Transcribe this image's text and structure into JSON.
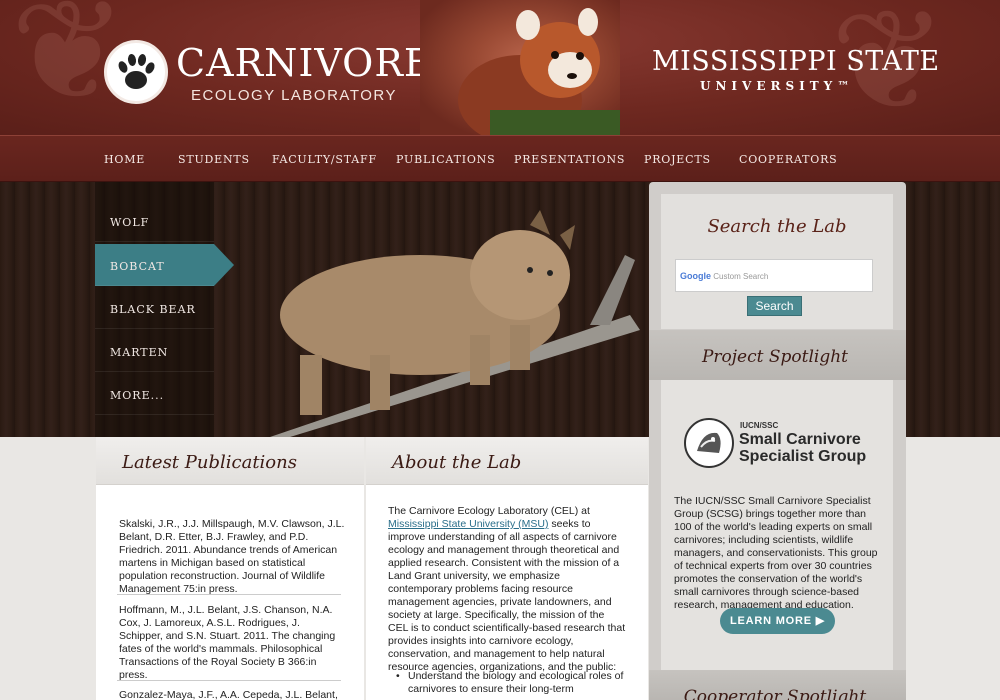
{
  "header": {
    "title_main": "CARNIVORE",
    "title_sub": "ECOLOGY LABORATORY",
    "university_main": "MISSISSIPPI STATE",
    "university_sub": "UNIVERSITY™"
  },
  "nav": {
    "items": [
      "HOME",
      "STUDENTS",
      "FACULTY/STAFF",
      "PUBLICATIONS",
      "PRESENTATIONS",
      "PROJECTS",
      "COOPERATORS"
    ]
  },
  "side_menu": {
    "items": [
      "WOLF",
      "BOBCAT",
      "BLACK BEAR",
      "MARTEN",
      "MORE..."
    ],
    "active": "BOBCAT"
  },
  "search": {
    "title": "Search the Lab",
    "brand": "Google",
    "placeholder": "Custom Search",
    "button_label": "Search"
  },
  "spotlight": {
    "title": "Project Spotlight",
    "logo_tag": "IUCN/SSC",
    "logo_name_line1": "Small Carnivore",
    "logo_name_line2": "Specialist Group",
    "text": "The IUCN/SSC Small Carnivore Specialist Group (SCSG) brings together more than 100 of the world's leading experts on small carnivores; including scientists, wildlife managers, and conservationists. This group of technical experts from over 30 countries promotes the conservation of the world's small carnivores through science-based research, management and education.",
    "button_label": "LEARN MORE ▶"
  },
  "cooperator": {
    "title": "Cooperator Spotlight"
  },
  "publications": {
    "title": "Latest Publications",
    "entries": [
      "Skalski, J.R., J.J. Millspaugh, M.V. Clawson, J.L. Belant, D.R. Etter, B.J. Frawley, and P.D. Friedrich. 2011. Abundance trends of American martens in Michigan based on statistical population reconstruction. Journal of Wildlife Management 75:in press.",
      "Hoffmann, M., J.L. Belant, J.S. Chanson, N.A. Cox, J. Lamoreux, A.S.L. Rodrigues, J. Schipper, and S.N. Stuart. 2011. The changing fates of the world's mammals. Philosophical Transactions of the Royal Society B 366:in press.",
      "Gonzalez-Maya, J.F., A.A. Cepeda, J.L. Belant,"
    ]
  },
  "about": {
    "title": "About the Lab",
    "intro_before_link": "The Carnivore Ecology Laboratory (CEL) at ",
    "link": "Mississippi State University (MSU)",
    "intro_after_link": " seeks to improve understanding of all aspects of carnivore ecology and management through theoretical and applied research. Consistent with the mission of a Land Grant university, we emphasize contemporary problems facing resource management agencies, private landowners, and society at large. Specifically, the mission of the CEL is to conduct scientifically-based research that provides insights into carnivore ecology, conservation, and management to help natural resource agencies, organizations, and the public:",
    "bullet": "Understand the biology and ecological roles of carnivores to ensure their long-term"
  },
  "colors": {
    "header_red": "#6e2820",
    "teal": "#4b8a91",
    "active_teal": "#3c7e86"
  }
}
